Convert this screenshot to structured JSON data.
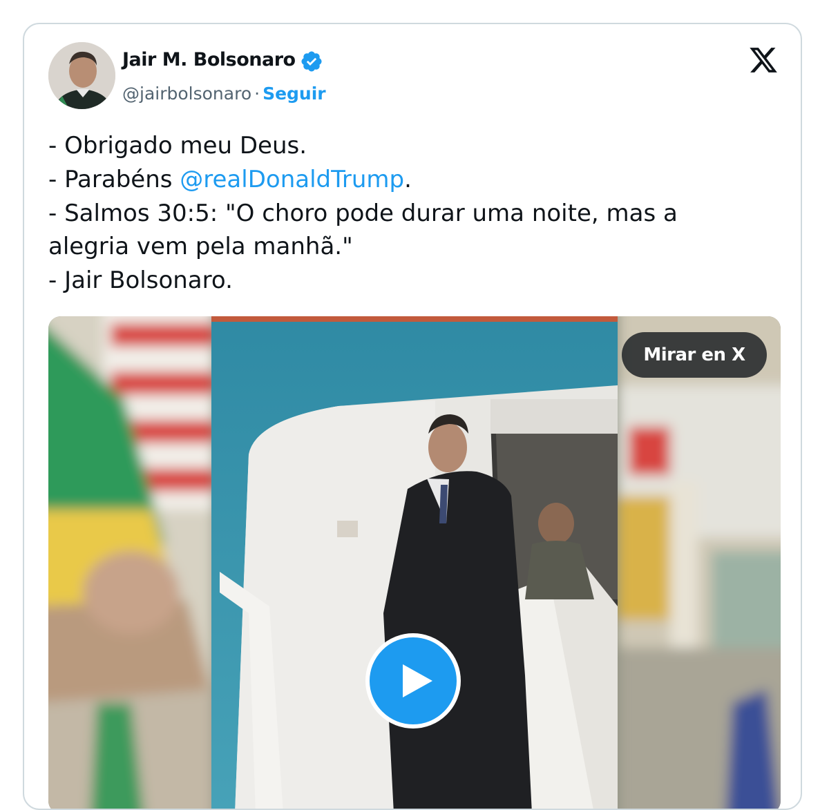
{
  "tweet": {
    "author": {
      "name": "Jair M. Bolsonaro",
      "handle": "@jairbolsonaro",
      "separator": "·",
      "follow_label": "Seguir",
      "verified": true,
      "avatar_icon": "profile-photo"
    },
    "platform_icon": "x-logo-icon",
    "text": {
      "line1": "- Obrigado meu Deus.",
      "line2_prefix": "- Parabéns ",
      "line2_mention": "@realDonaldTrump",
      "line2_suffix": ".",
      "line3": "- Salmos 30:5: \"O choro pode durar uma noite, mas a",
      "line4": "alegria vem pela manhã.\"",
      "line5": "- Jair Bolsonaro."
    },
    "media": {
      "type": "video",
      "watch_label": "Mirar en X",
      "play_icon": "play-icon"
    }
  },
  "colors": {
    "accent": "#1d9bf0",
    "text_primary": "#0f1419",
    "text_secondary": "#536471",
    "border": "#cfd9de"
  }
}
